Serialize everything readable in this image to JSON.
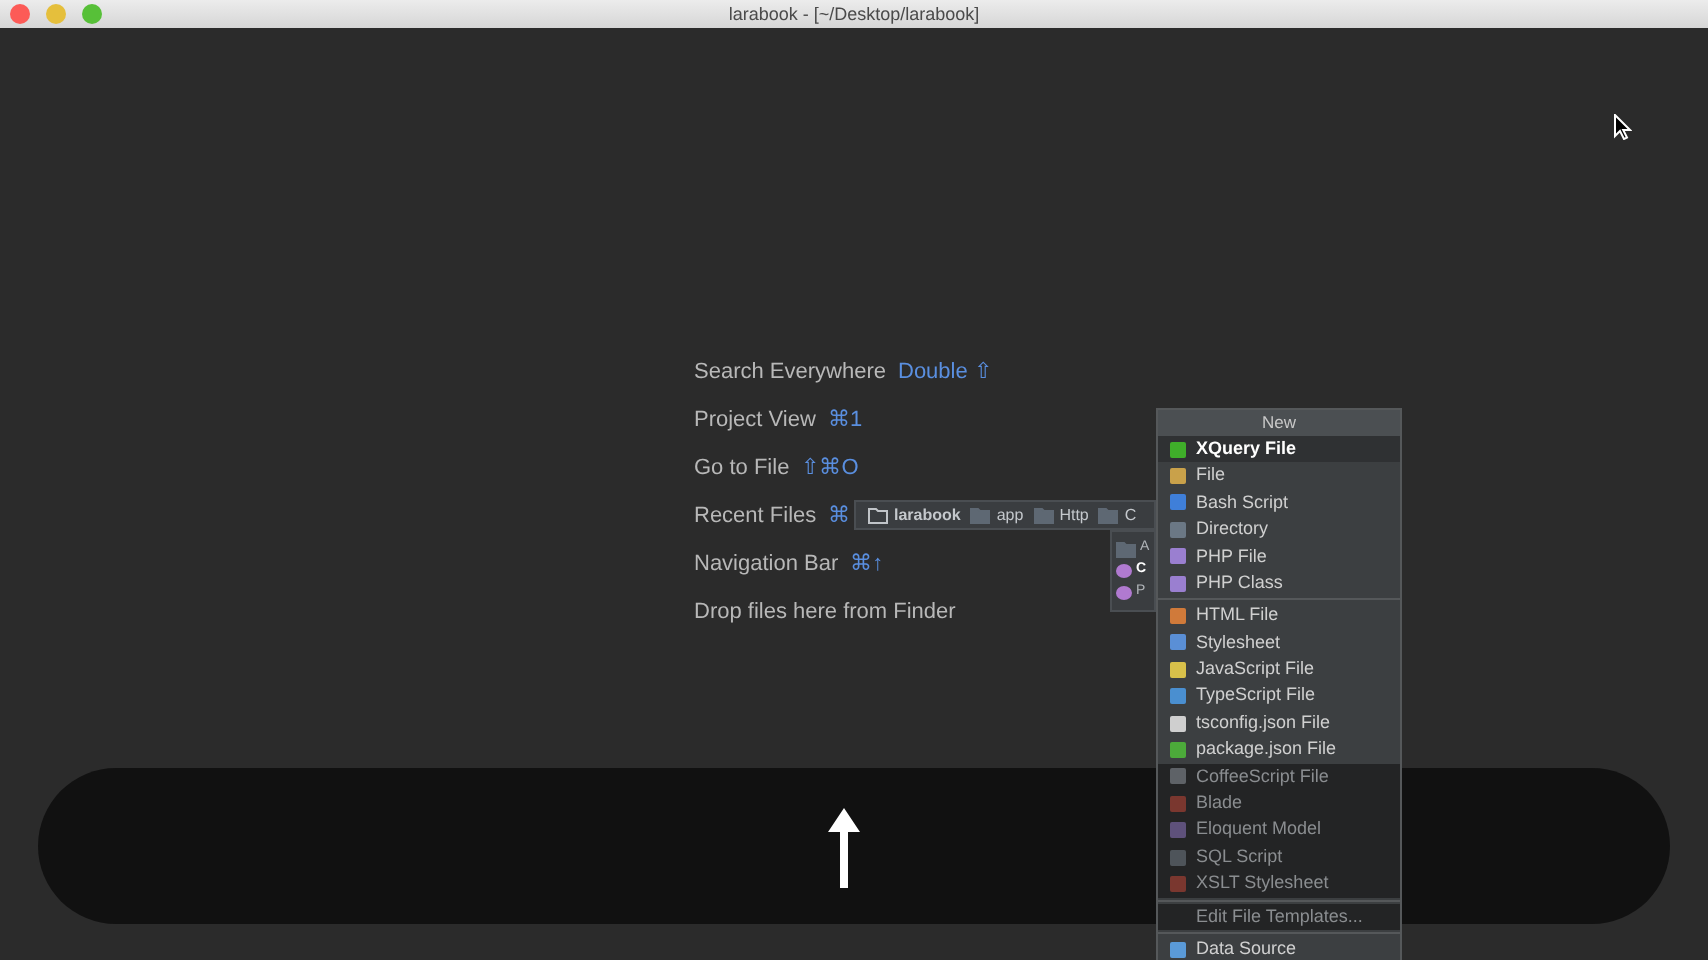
{
  "window": {
    "title": "larabook - [~/Desktop/larabook]"
  },
  "hints": [
    {
      "label": "Search Everywhere",
      "shortcut": "Double ⇧"
    },
    {
      "label": "Project View",
      "shortcut": "⌘1"
    },
    {
      "label": "Go to File",
      "shortcut": "⇧⌘O"
    },
    {
      "label": "Recent Files",
      "shortcut": "⌘"
    },
    {
      "label": "Navigation Bar",
      "shortcut": "⌘↑"
    },
    {
      "label": "Drop files here from Finder"
    }
  ],
  "breadcrumb": [
    "larabook",
    "app",
    "Http",
    "C"
  ],
  "breadcrumb_popup": [
    {
      "label": "A",
      "selected": false
    },
    {
      "label": "C",
      "selected": true
    },
    {
      "label": "P",
      "selected": false
    }
  ],
  "new_menu": {
    "title": "New",
    "items": [
      {
        "label": "XQuery File",
        "selected": true,
        "disabled": false
      },
      {
        "label": "File",
        "selected": false,
        "disabled": false
      },
      {
        "label": "Bash Script",
        "selected": false,
        "disabled": false
      },
      {
        "label": "Directory",
        "selected": false,
        "disabled": false
      },
      {
        "label": "PHP File",
        "selected": false,
        "disabled": false
      },
      {
        "label": "PHP Class",
        "selected": false,
        "disabled": false,
        "separator_after": true
      },
      {
        "label": "HTML File",
        "selected": false,
        "disabled": false
      },
      {
        "label": "Stylesheet",
        "selected": false,
        "disabled": false
      },
      {
        "label": "JavaScript File",
        "selected": false,
        "disabled": false
      },
      {
        "label": "TypeScript File",
        "selected": false,
        "disabled": false
      },
      {
        "label": "tsconfig.json File",
        "selected": false,
        "disabled": false
      },
      {
        "label": "package.json File",
        "selected": false,
        "disabled": false
      },
      {
        "label": "CoffeeScript File",
        "selected": false,
        "disabled": true
      },
      {
        "label": "Blade",
        "selected": false,
        "disabled": true
      },
      {
        "label": "Eloquent Model",
        "selected": false,
        "disabled": true
      },
      {
        "label": "SQL Script",
        "selected": false,
        "disabled": true
      },
      {
        "label": "XSLT Stylesheet",
        "selected": false,
        "disabled": true,
        "separator_after": true
      },
      {
        "label": "Edit File Templates...",
        "selected": false,
        "disabled": true,
        "separator_after": true
      },
      {
        "label": "Data Source",
        "selected": false,
        "disabled": false
      }
    ]
  }
}
